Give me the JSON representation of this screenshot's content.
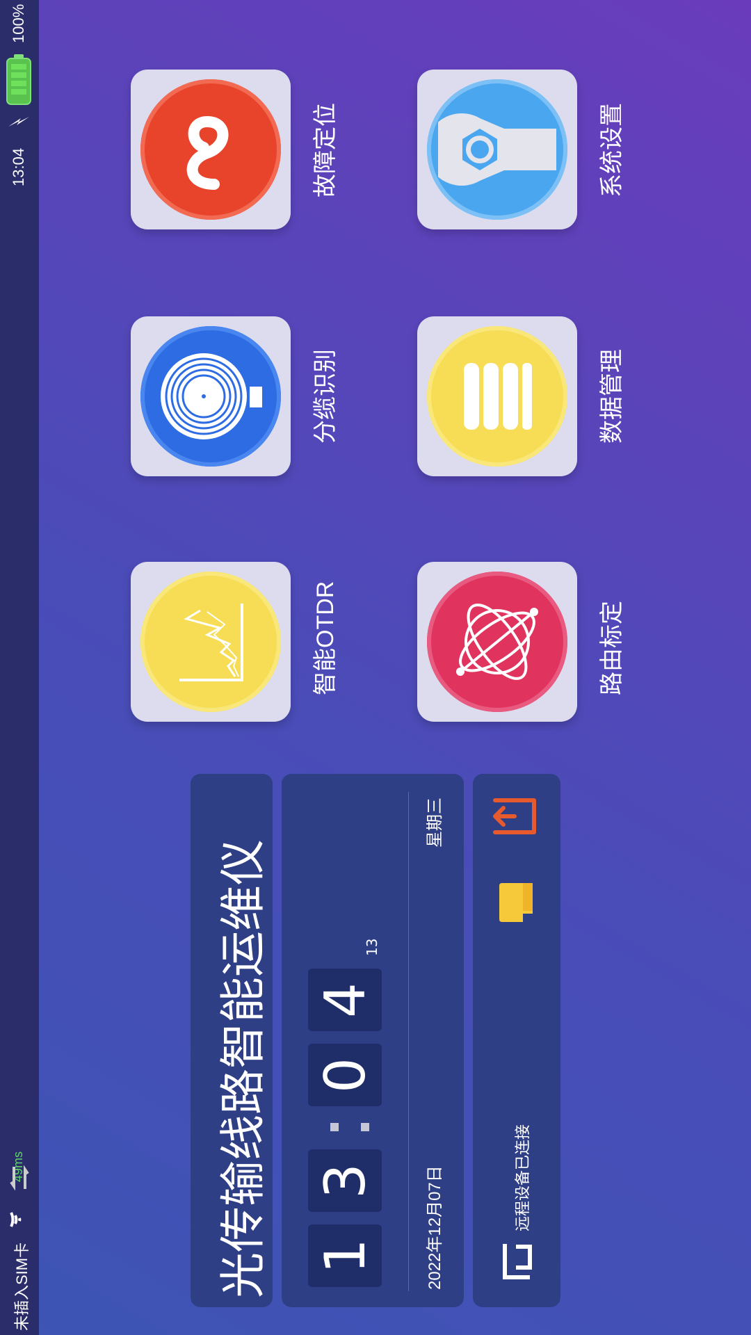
{
  "status": {
    "battery": "100%",
    "time": "13:04",
    "latency": "49ms",
    "sim": "未插入SIM卡"
  },
  "apps": [
    {
      "label": "故障定位",
      "icon": "lastfm-icon",
      "color": "#e8442c"
    },
    {
      "label": "分缆识别",
      "icon": "vinyl-record-icon",
      "color": "#2d6ce3"
    },
    {
      "label": "智能OTDR",
      "icon": "chart-icon",
      "color": "#f6dd55"
    },
    {
      "label": "系统设置",
      "icon": "wrench-icon",
      "color": "#4aa6ef"
    },
    {
      "label": "数据管理",
      "icon": "database-icon",
      "color": "#f6dd55"
    },
    {
      "label": "路由标定",
      "icon": "orbit-icon",
      "color": "#e0345f"
    }
  ],
  "title": "光传输线路智能运维仪",
  "clock": {
    "h1": "1",
    "h2": "3",
    "m1": "0",
    "m2": "4",
    "seconds": "13",
    "date": "2022年12月07日",
    "weekday": "星期三"
  },
  "remote": {
    "text": "远程设备已连接"
  },
  "colors": {
    "accent": "#e65a2e",
    "folder": "#f5c93a"
  }
}
